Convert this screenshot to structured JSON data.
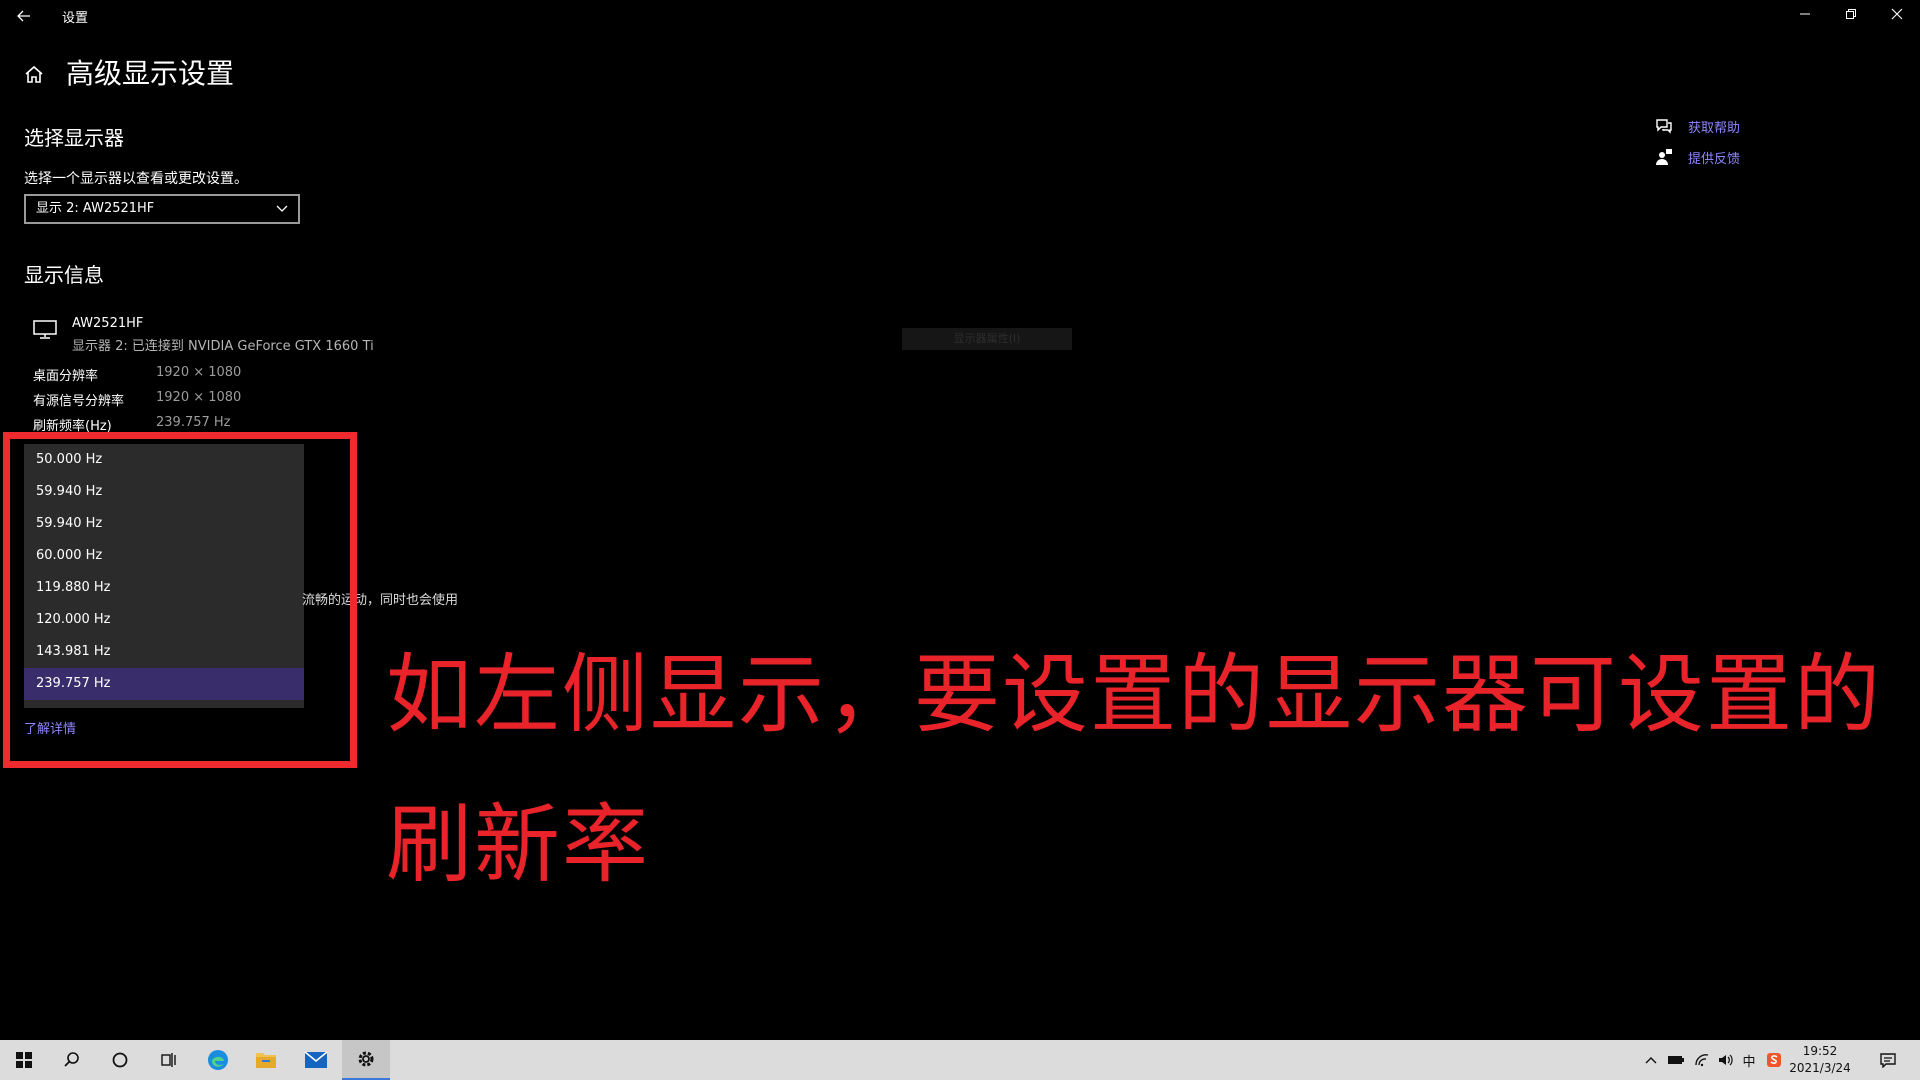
{
  "window": {
    "title": "设置",
    "back_icon": "back-arrow-icon",
    "controls": [
      "minimize-icon",
      "restore-icon",
      "close-icon"
    ]
  },
  "page": {
    "title": "高级显示设置",
    "home_icon": "home-icon"
  },
  "select_display": {
    "heading": "选择显示器",
    "description": "选择一个显示器以查看或更改设置。",
    "selected": "显示 2: AW2521HF"
  },
  "display_info": {
    "heading": "显示信息",
    "monitor_name": "AW2521HF",
    "monitor_sub": "显示器 2: 已连接到 NVIDIA GeForce GTX 1660 Ti",
    "rows": [
      {
        "label": "桌面分辨率",
        "value": "1920 × 1080"
      },
      {
        "label": "有源信号分辨率",
        "value": "1920 × 1080"
      },
      {
        "label": "刷新频率(Hz)",
        "value": "239.757 Hz"
      }
    ],
    "faint_button": "显示器属性(I)"
  },
  "refresh_dropdown": {
    "options": [
      "50.000 Hz",
      "59.940 Hz",
      "59.940 Hz",
      "60.000 Hz",
      "119.880 Hz",
      "120.000 Hz",
      "143.981 Hz",
      "239.757 Hz"
    ],
    "selected_index": 7
  },
  "partial_text": "流畅的运动，同时也会使用",
  "learn_more": "了解详情",
  "annotation": {
    "line1": "如左侧显示，要设置的显示器可设置的",
    "line2": "刷新率",
    "color": "#e9232a"
  },
  "help_links": [
    {
      "label": "获取帮助",
      "icon": "chat-help-icon"
    },
    {
      "label": "提供反馈",
      "icon": "feedback-person-icon"
    }
  ],
  "taskbar": {
    "items": [
      "start-icon",
      "search-icon",
      "cortana-icon",
      "task-view-icon",
      "edge-icon",
      "file-explorer-icon",
      "mail-icon",
      "settings-icon"
    ],
    "clock_time": "19:52",
    "clock_date": "2021/3/24",
    "ime": "中"
  }
}
